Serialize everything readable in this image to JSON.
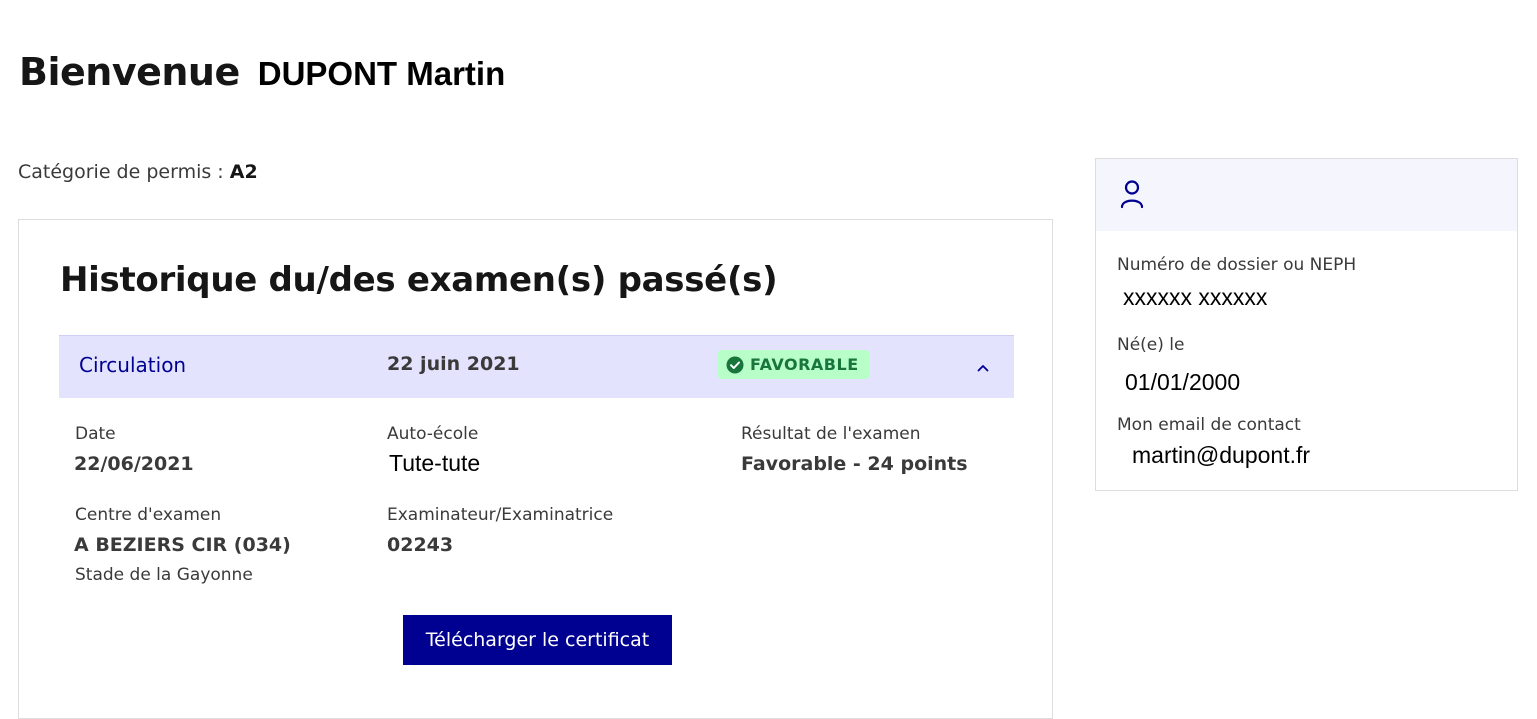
{
  "header": {
    "welcome_label": "Bienvenue",
    "user_name": "DUPONT Martin"
  },
  "license": {
    "category_label": "Catégorie de permis : ",
    "category_value": "A2"
  },
  "history": {
    "title": "Historique du/des examen(s) passé(s)",
    "exam": {
      "type": "Circulation",
      "date": "22 juin 2021",
      "status": "FAVORABLE",
      "status_color": "#18753c",
      "status_bg": "#b8fec9",
      "status_icon": "check-circle-icon",
      "expanded": true,
      "details": {
        "date_label": "Date",
        "date_value": "22/06/2021",
        "school_label": "Auto-école",
        "school_value": "Tute-tute",
        "result_label": "Résultat de l'examen",
        "result_value": "Favorable - 24 points",
        "center_label": "Centre d'examen",
        "center_value": "A BEZIERS CIR (034)",
        "center_address": "Stade de la Gayonne",
        "examiner_label": "Examinateur/Examinatrice",
        "examiner_value": "02243"
      },
      "download_label": "Télécharger le certificat"
    }
  },
  "profile": {
    "icon": "user-icon",
    "file_number_label": "Numéro de dossier ou NEPH",
    "file_number_value": "xxxxxx xxxxxx",
    "birth_label": "Né(e) le",
    "birth_value": "01/01/2000",
    "email_label": "Mon email de contact",
    "email_value": "martin@dupont.fr"
  },
  "colors": {
    "primary": "#000091",
    "accordion_bg": "#e3e3fd",
    "profile_header_bg": "#f5f5fe"
  }
}
